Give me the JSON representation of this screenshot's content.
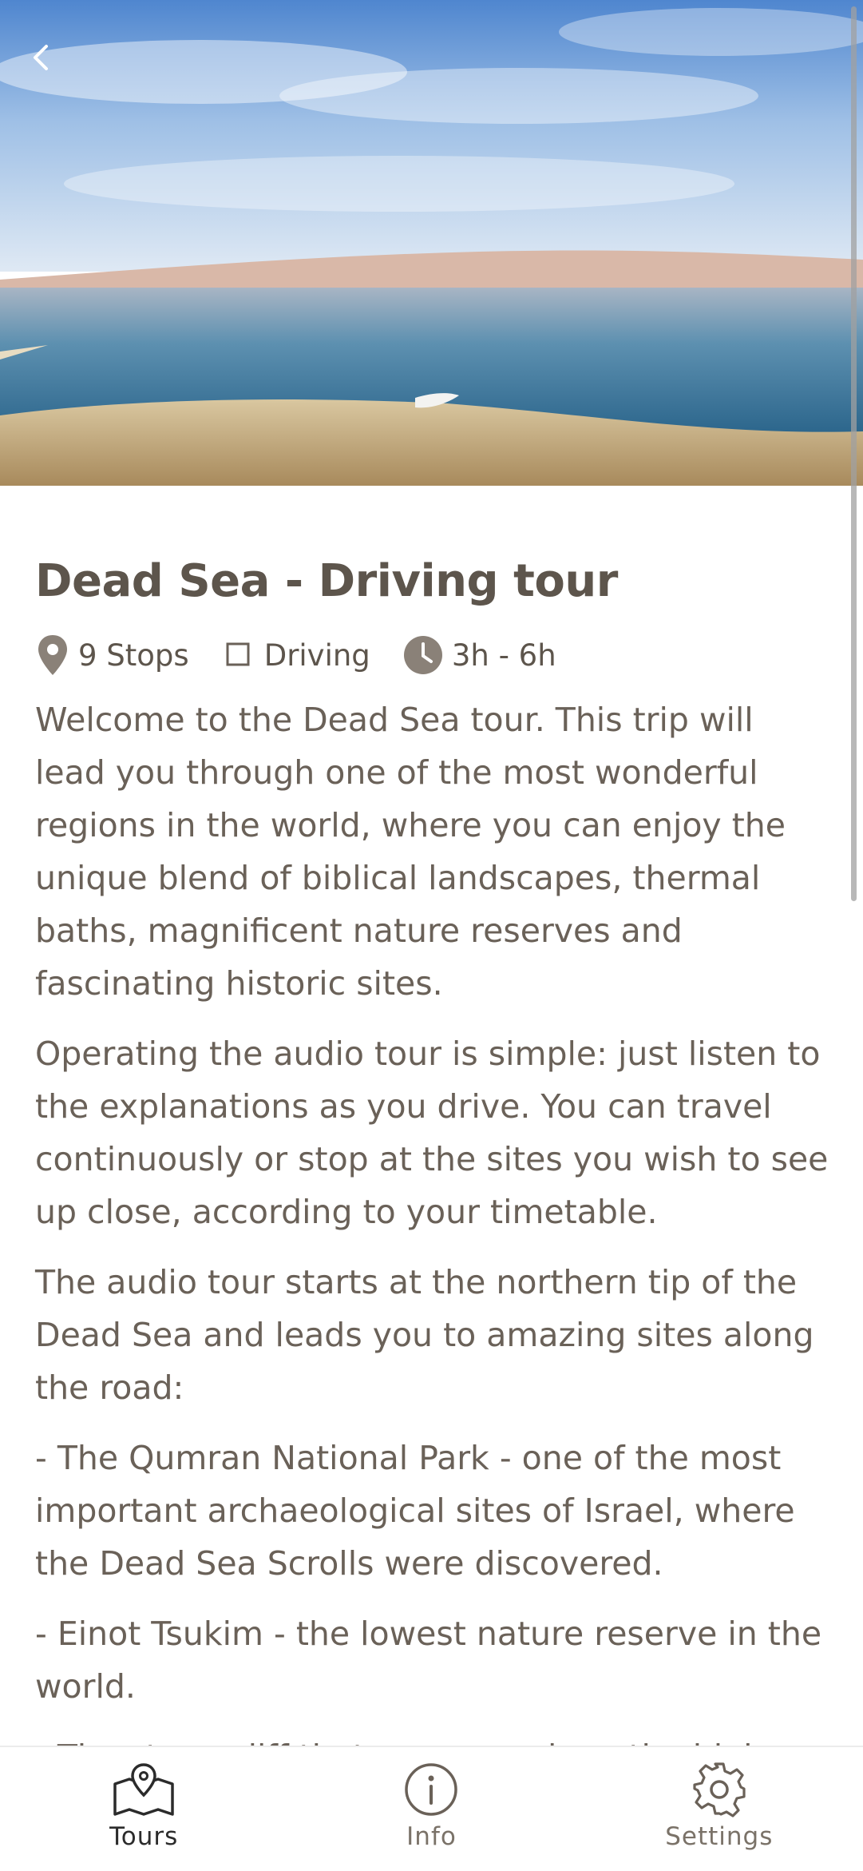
{
  "header": {
    "back_icon": "chevron-left-icon"
  },
  "tour": {
    "title": "Dead Sea - Driving tour",
    "meta": {
      "stops": "9 Stops",
      "mode": "Driving",
      "duration": "3h - 6h"
    },
    "paragraphs": [
      "Welcome to the Dead Sea tour. This trip will lead you through one of the most wonderful regions in the world, where you can enjoy the unique blend of biblical landscapes, thermal baths, magnificent nature reserves and fascinating historic sites.",
      "Operating the audio tour is simple: just listen to the explanations as you drive. You can travel continuously or stop at the sites you wish to see up close, according to your timetable.",
      "The audio tour starts at the northern tip of the Dead Sea and leads you to amazing sites along the road:",
      "- The Qumran National Park - one of the most important archaeological sites of Israel, where the Dead Sea Scrolls were discovered.",
      "- Einot Tsukim - the lowest nature reserve in the world.",
      "- The steep cliff that can runs along the highway"
    ]
  },
  "bottom_nav": {
    "items": [
      {
        "label": "Tours",
        "icon": "map-pin-icon",
        "active": true
      },
      {
        "label": "Info",
        "icon": "info-icon",
        "active": false
      },
      {
        "label": "Settings",
        "icon": "gear-icon",
        "active": false
      }
    ]
  },
  "colors": {
    "text": "#6a6158",
    "title": "#5d554c",
    "nav_active": "#2b2b2b"
  }
}
